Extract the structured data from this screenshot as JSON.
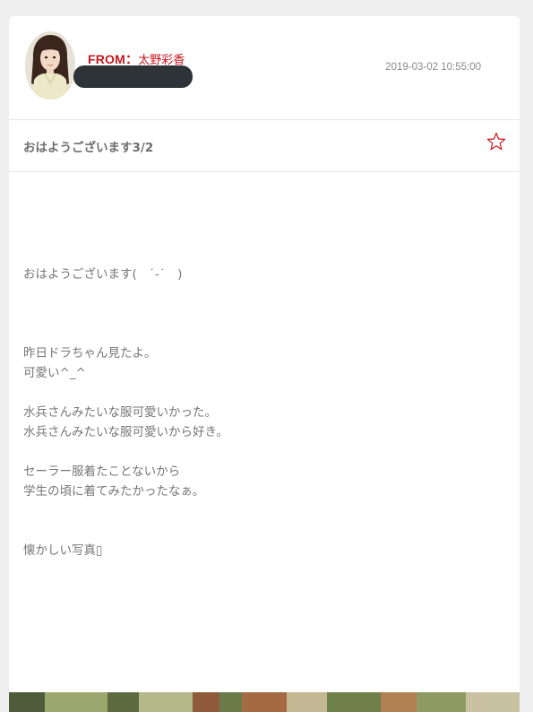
{
  "message": {
    "from_label": "FROM：",
    "sender_name": "太野彩香",
    "timestamp": "2019-03-02 10:55:00",
    "subject": "おはようございます3/2",
    "body_lines": [
      "おはようございます(　˙-˙　)",
      "",
      "",
      "",
      "昨日ドラちゃん見たよ。",
      "可愛い^_^",
      "",
      "水兵さんみたいな服可愛いかった。",
      "水兵さんみたいな服可愛いから好き。",
      "",
      "セーラー服着たことないから",
      "学生の頃に着てみたかったなぁ。",
      "",
      "",
      "懐かしい写真▯"
    ]
  },
  "icons": {
    "favorite": "star-outline-icon",
    "avatar": "avatar"
  },
  "colors": {
    "accent": "#c8161d",
    "text": "#777777",
    "background": "#efefef"
  }
}
